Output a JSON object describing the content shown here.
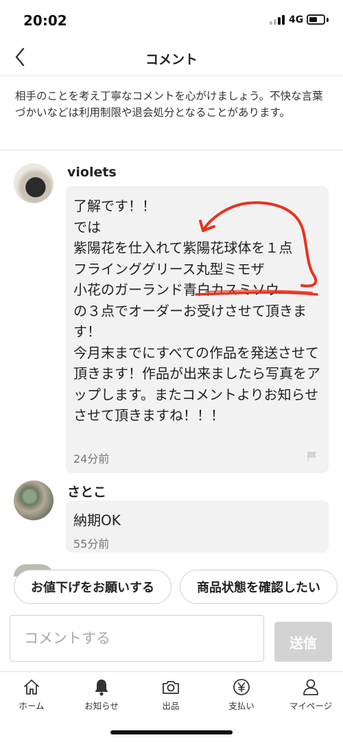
{
  "status_bar": {
    "time": "20:02",
    "network": "4G"
  },
  "header": {
    "title": "コメント"
  },
  "notice": "相手のことを考え丁寧なコメントを心がけましょう。不快な言葉づかいなどは利用制限や退会処分となることがあります。",
  "comments": [
    {
      "user": "violets",
      "text": "了解です！！\nでは\n紫陽花を仕入れて紫陽花球体を１点\nフラインググリース丸型ミモザ\n小花のガーランド青白カスミソウ\nの３点でオーダーお受けさせて頂きます！\n今月末までにすべての作品を発送させて頂きます！作品が出来ましたら写真をアップします。またコメントよりお知らせさせて頂きますね！！！",
      "time": "24分前"
    },
    {
      "user": "さとこ",
      "text": "納期OK",
      "time": "55分前"
    }
  ],
  "suggestions": [
    "お値下げをお願いする",
    "商品状態を確認したい"
  ],
  "input": {
    "placeholder": "コメントする",
    "send_label": "送信"
  },
  "tabs": [
    {
      "label": "ホーム",
      "icon": "home-icon"
    },
    {
      "label": "お知らせ",
      "icon": "bell-icon"
    },
    {
      "label": "出品",
      "icon": "camera-icon"
    },
    {
      "label": "支払い",
      "icon": "yen-icon"
    },
    {
      "label": "マイページ",
      "icon": "person-icon"
    }
  ],
  "colors": {
    "send_button": "#d3d3d3",
    "annotation": "#e8321e",
    "bubble": "#f2f2f2"
  }
}
